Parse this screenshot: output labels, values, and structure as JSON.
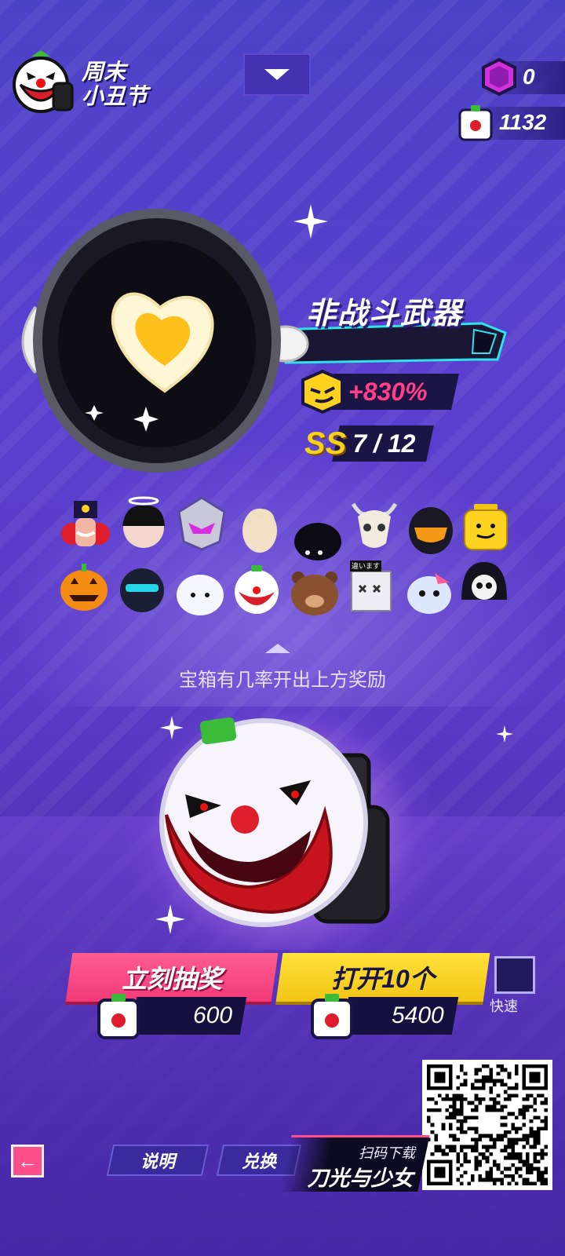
{
  "header": {
    "event_title_line1": "周末",
    "event_title_line2": "小丑节",
    "event_icon": "clown-mascot-icon"
  },
  "currencies": [
    {
      "icon": "purple-gem-icon",
      "value": "0"
    },
    {
      "icon": "clown-box-token-icon",
      "value": "1132"
    }
  ],
  "weapon": {
    "name": "非战斗武器",
    "icon": "frying-pan-with-heart-egg",
    "bonus": "+830%",
    "bonus_icon": "smirk-face-icon",
    "grade": "SS",
    "count": "7 / 12"
  },
  "rewards": {
    "row1": [
      "nutcracker-head",
      "angel-black-hair-head",
      "mech-helmet-head",
      "blonde-hair-head",
      "black-blob-head",
      "horned-skull-head",
      "golden-visor-helmet",
      "yellow-lego-head"
    ],
    "row2": [
      "jack-o-lantern-head",
      "blue-knight-helmet",
      "white-blob-head",
      "clown-head",
      "brown-bear-head",
      "dead-box-head",
      "fish-head",
      "grim-reaper-head"
    ],
    "dead_box_tag": "違います",
    "hint": "宝箱有几率开出上方奖励"
  },
  "actions": {
    "draw_now": {
      "label": "立刻抽奖",
      "cost": "600"
    },
    "open_ten": {
      "label": "打开10个",
      "cost": "5400"
    },
    "quick_label": "快速"
  },
  "footer": {
    "back_icon": "back-arrow-icon",
    "tab_info": "说明",
    "tab_exchange": "兑换",
    "promo_small": "扫码下载",
    "promo_big": "刀光与少女"
  },
  "colors": {
    "bg": "#5a3fcf",
    "accent_pink": "#f13a77",
    "accent_yellow": "#f2c515",
    "bonus_pink": "#ff3f86",
    "grade_gold": "#f6d21b"
  }
}
